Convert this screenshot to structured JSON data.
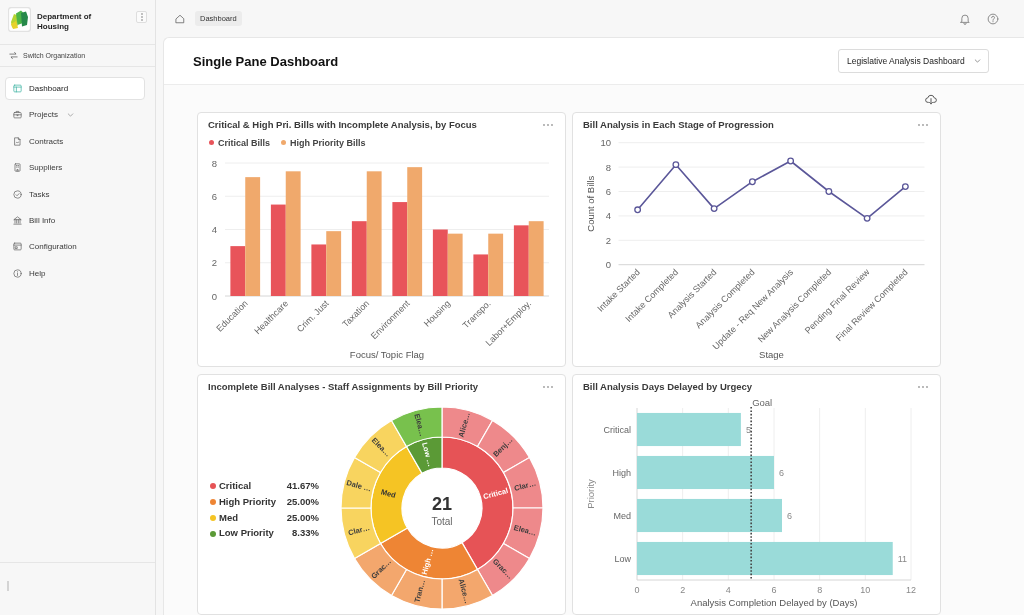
{
  "sidebar": {
    "organization": "Department of Housing",
    "switch_label": "Switch Organization",
    "items": [
      {
        "label": "Dashboard",
        "kind": "link",
        "selected": true
      },
      {
        "label": "Projects",
        "kind": "group",
        "selected": false,
        "expanded": false
      },
      {
        "label": "Contracts",
        "kind": "link",
        "selected": false
      },
      {
        "label": "Suppliers",
        "kind": "link",
        "selected": false
      },
      {
        "label": "Tasks",
        "kind": "link",
        "selected": false
      },
      {
        "label": "Bill Info",
        "kind": "link",
        "selected": false
      },
      {
        "label": "Configuration",
        "kind": "link",
        "selected": false
      },
      {
        "label": "Help",
        "kind": "link",
        "selected": false
      }
    ]
  },
  "header": {
    "breadcrumb": "Dashboard"
  },
  "page": {
    "title": "Single Pane Dashboard",
    "dashboard_select": "Legislative Analysis Dashboard"
  },
  "cards": [
    {
      "chart_data": {
        "type": "bar",
        "title": "Critical & High Pri. Bills with Incomplete Analysis, by Focus",
        "xlabel": "Focus/ Topic Flag",
        "categories": [
          "Education",
          "Healthcare",
          "Crim. Just",
          "Taxation",
          "Environment",
          "Housing",
          "Transpo.",
          "Labor+Employ."
        ],
        "series": [
          {
            "name": "Critical Bills",
            "color": "#e8545a",
            "values": [
              3,
              5.5,
              3.1,
              4.5,
              5.65,
              4,
              2.5,
              4.25
            ]
          },
          {
            "name": "High Priority Bills",
            "color": "#f0a96c",
            "values": [
              7.15,
              7.5,
              3.9,
              7.5,
              7.75,
              3.75,
              3.75,
              4.5
            ]
          }
        ],
        "ylim": [
          0,
          8
        ],
        "yticks": [
          0,
          2,
          4,
          6,
          8
        ],
        "grid": true
      }
    },
    {
      "chart_data": {
        "type": "line",
        "title": "Bill Analysis in Each Stage of Progression",
        "xlabel": "Stage",
        "ylabel": "Count of Bills",
        "categories": [
          "Intake Started",
          "Intake Completed",
          "Analysis Started",
          "Analysis Completed",
          "Update - Req New Analysis",
          "New Analysis Completed",
          "Pending Final Review",
          "Final Review Completed"
        ],
        "series": [
          {
            "color": "#5b5799",
            "marker": "circle",
            "values": [
              4.5,
              8.2,
              4.6,
              6.8,
              8.5,
              6.0,
              3.8,
              6.4
            ]
          }
        ],
        "ylim": [
          0,
          10
        ],
        "yticks": [
          0,
          2,
          4,
          6,
          8,
          10
        ],
        "grid": true
      }
    },
    {
      "legend": [
        {
          "label": "Critical",
          "share": "41.67%",
          "color": "#e65356"
        },
        {
          "label": "High Priority",
          "share": "25.00%",
          "color": "#ee8534"
        },
        {
          "label": "Med",
          "share": "25.00%",
          "color": "#f5c424"
        },
        {
          "label": "Low Priority",
          "share": "8.33%",
          "color": "#5b9a36"
        }
      ],
      "chart_data": {
        "type": "donut",
        "title": "Incomplete Bill Analyses - Staff Assignments by Bill Priority",
        "categories": [
          "Critical",
          "High …",
          "Med",
          "Low …"
        ],
        "values": [
          41.67,
          25,
          25,
          8.33
        ]
      },
      "outer_ring": {
        "chart_data": {
          "type": "donut",
          "categories": [
            "Alice…",
            "Benj…",
            "Clar…",
            "Elea…",
            "Grac…",
            "Alice…",
            "Tran…",
            "Grac…",
            "Clar…",
            "Dale …",
            "Elea…",
            "Elea…"
          ],
          "values": [
            8.33,
            8.33,
            8.33,
            8.33,
            8.33,
            8.33,
            8.33,
            8.33,
            8.33,
            8.33,
            8.33,
            8.33
          ]
        }
      },
      "center": {
        "value": "21",
        "label": "Total"
      }
    },
    {
      "chart_data": {
        "type": "bar",
        "orientation": "horizontal",
        "title": "Bill Analysis Days Delayed by Urgecy",
        "xlabel": "Analysis Completion Delayed by (Days)",
        "ylabel": "Priority",
        "categories": [
          "Critical",
          "High",
          "Med",
          "Low"
        ],
        "series": [
          {
            "color": "#9adbd9",
            "values": [
              4.55,
              6,
              6.35,
              11.2
            ]
          }
        ],
        "value_labels": [
          "5",
          "6",
          "6",
          "11"
        ],
        "xlim": [
          0,
          12
        ],
        "xticks": [
          0,
          2,
          4,
          6,
          8,
          10,
          12
        ],
        "grid": true,
        "ref_lines": [
          {
            "axis": "x",
            "value": 5,
            "label": "Goal"
          }
        ]
      }
    }
  ]
}
